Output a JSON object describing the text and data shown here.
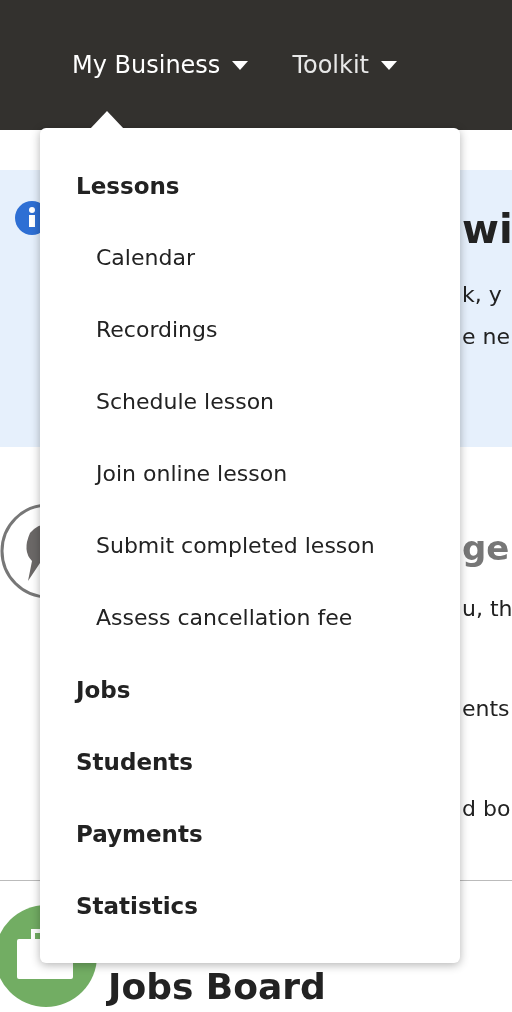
{
  "nav": [
    {
      "label": "My Business",
      "expanded": true
    },
    {
      "label": "Toolkit",
      "expanded": false
    }
  ],
  "menu": [
    {
      "label": "Lessons",
      "children": [
        {
          "label": "Calendar"
        },
        {
          "label": "Recordings"
        },
        {
          "label": "Schedule lesson"
        },
        {
          "label": "Join online lesson"
        },
        {
          "label": "Submit completed lesson"
        },
        {
          "label": "Assess cancellation fee"
        }
      ]
    },
    {
      "label": "Jobs"
    },
    {
      "label": "Students"
    },
    {
      "label": "Payments"
    },
    {
      "label": "Statistics"
    }
  ],
  "banner": {
    "heading": "wi",
    "lines": [
      "k, y",
      "e ne"
    ]
  },
  "messages": {
    "heading": "ge",
    "lines": [
      "u, th",
      "ents",
      "d bo"
    ]
  },
  "jobs_board": {
    "title": "Jobs Board"
  }
}
